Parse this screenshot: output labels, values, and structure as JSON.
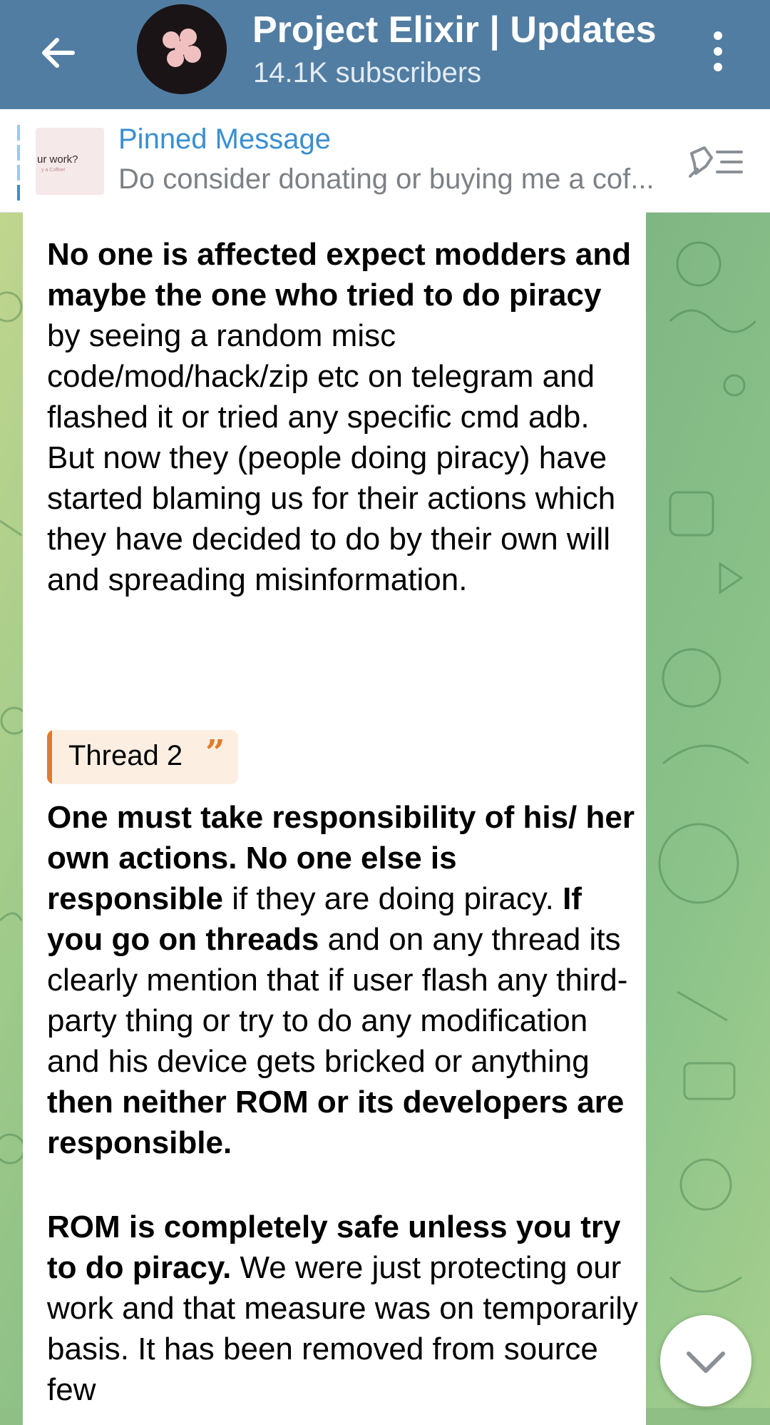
{
  "header": {
    "title": "Project Elixir | Updates",
    "subtitle": "14.1K subscribers",
    "back_icon": "arrow-left-icon",
    "menu_icon": "more-vertical-icon",
    "color": "#517da2"
  },
  "pinned": {
    "title": "Pinned Message",
    "text": "Do consider donating or buying me a cof...",
    "thumb_text": "ur work?",
    "thumb_small": "y a Coffee!",
    "icon": "pinned-list-icon",
    "title_color": "#3a8fd1"
  },
  "message": {
    "p1": {
      "b1": "No one is affected expect modders and maybe the one who tried to do piracy",
      "t1": " by seeing a random misc code/mod/hack/zip etc on telegram and flashed it or tried any specific cmd adb. But now they (people doing piracy) have started blaming us for their actions which they have decided to do by their own will and spreading misinformation."
    },
    "quote": {
      "label": "Thread 2",
      "mark": "”",
      "accent": "#e07b2e"
    },
    "p2": {
      "b1": "One must take responsibility of his/ her own actions. No one else is responsible",
      "t1": " if they are doing piracy. ",
      "b2": "If you go on threads",
      "t2": " and on any thread its clearly mention that if user flash any third-party thing or try to do any modification and his device gets bricked or anything ",
      "b3": "then neither ROM or its developers are responsible."
    },
    "p3": {
      "b1": "ROM is completely safe unless you try to do piracy.",
      "t1": " We were just protecting our work and that measure was on  temporarily basis. It has been removed from source few"
    }
  },
  "scroll_button": {
    "icon": "chevron-down-icon"
  }
}
